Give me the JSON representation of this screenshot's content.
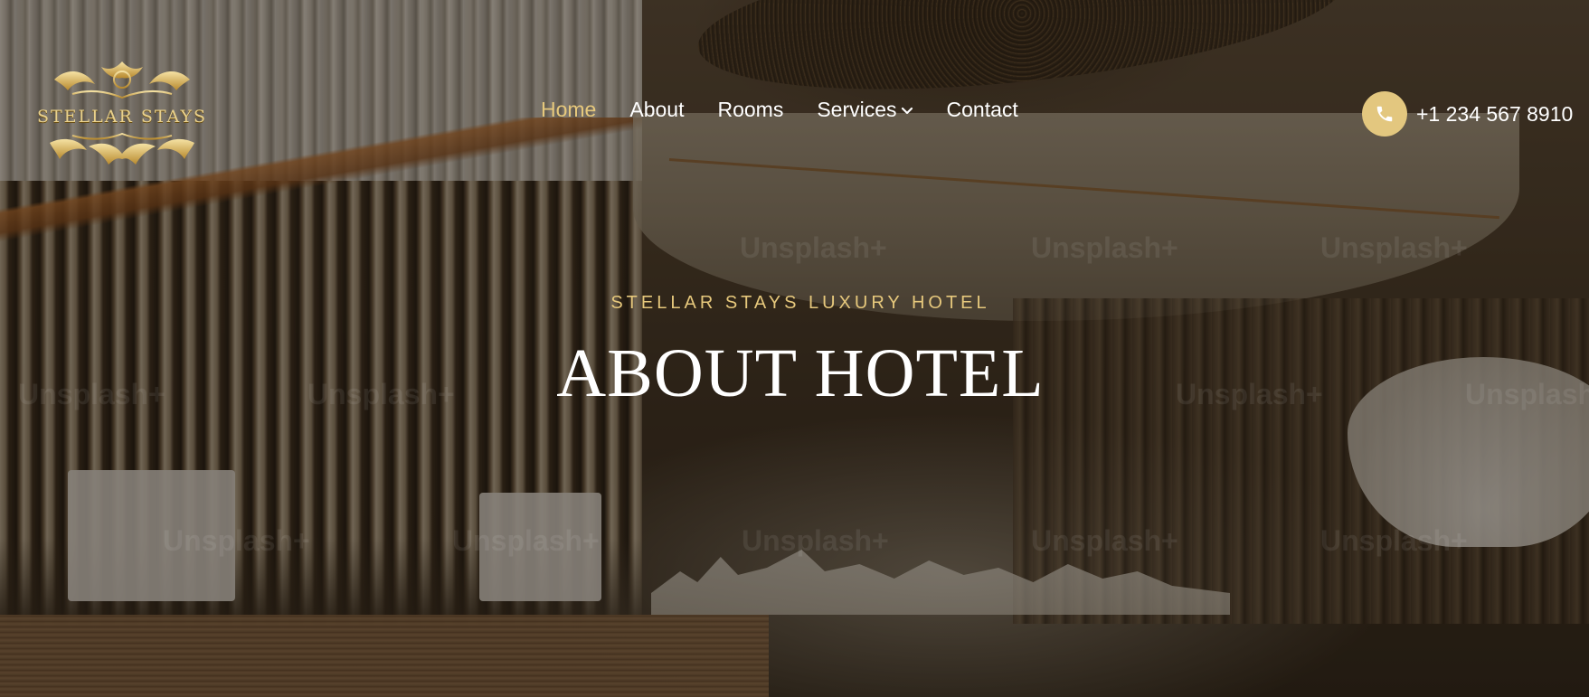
{
  "brand": {
    "logo_text": "STELLAR STAYS"
  },
  "nav": {
    "items": [
      {
        "label": "Home",
        "active": true
      },
      {
        "label": "About",
        "active": false
      },
      {
        "label": "Rooms",
        "active": false
      },
      {
        "label": "Services",
        "active": false,
        "has_dropdown": true
      },
      {
        "label": "Contact",
        "active": false
      }
    ]
  },
  "contact": {
    "phone": "+1 234 567 8910",
    "icon": "phone-icon"
  },
  "hero": {
    "eyebrow": "STELLAR STAYS LUXURY HOTEL",
    "title": "ABOUT HOTEL"
  },
  "watermark": {
    "text": "Unsplash+"
  },
  "colors": {
    "accent": "#e6c87c",
    "phone_circle": "#e3c77f",
    "text": "#ffffff"
  }
}
